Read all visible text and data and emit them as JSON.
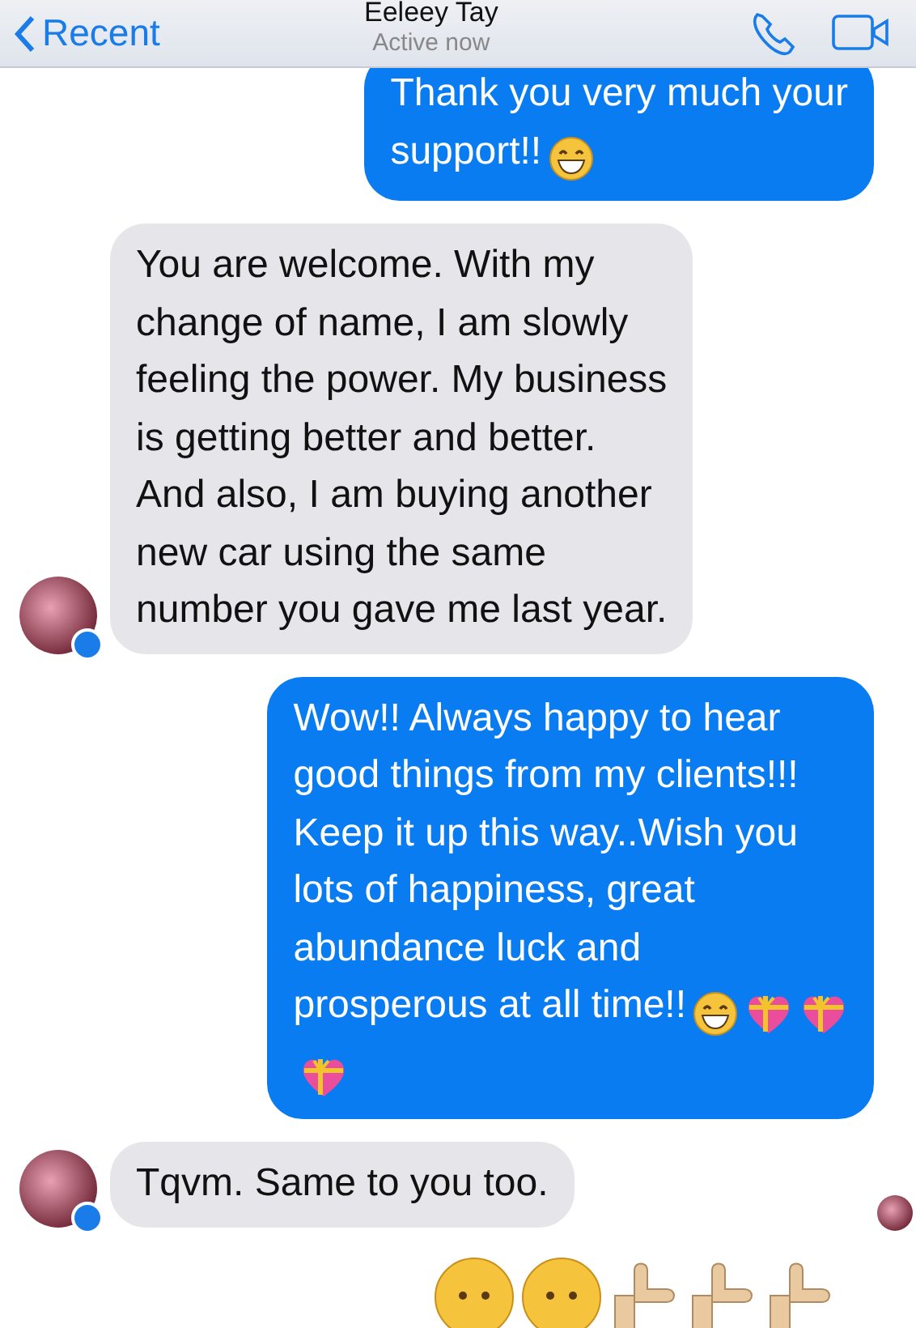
{
  "header": {
    "back_label": "Recent",
    "title": "Eeleey Tay",
    "status": "Active now"
  },
  "messages": [
    {
      "kind": "outgoing",
      "lines": [
        {
          "text": "Thank you very much your"
        },
        {
          "text": "support!!",
          "emoji": [
            {
              "kind": "grin"
            }
          ]
        }
      ]
    },
    {
      "kind": "incoming",
      "avatar": true,
      "lines": [
        {
          "text": "You are welcome.  With my"
        },
        {
          "text": "change of name, I am slowly"
        },
        {
          "text": "feeling the power. My business"
        },
        {
          "text": "is getting better and better."
        },
        {
          "text": "And also, I  am buying another"
        },
        {
          "text": "new car using the same"
        },
        {
          "text": "number you gave me last year."
        }
      ]
    },
    {
      "kind": "outgoing",
      "lines": [
        {
          "text": "Wow!! Always happy to hear"
        },
        {
          "text": "good things from my clients!!!"
        },
        {
          "text": "Keep it up this way..Wish you"
        },
        {
          "text": "lots of happiness, great"
        },
        {
          "text": "abundance luck and"
        },
        {
          "text": "prosperous at all time!!",
          "emoji": [
            {
              "kind": "grin"
            },
            {
              "kind": "gift-heart"
            },
            {
              "kind": "gift-heart"
            }
          ]
        },
        {
          "emoji": [
            {
              "kind": "gift-heart"
            }
          ]
        }
      ]
    },
    {
      "kind": "incoming",
      "avatar": true,
      "lines": [
        {
          "text": "Tqvm. Same to you too."
        }
      ]
    }
  ],
  "read_receipt": true,
  "bottom_emoji": [
    {
      "kind": "face"
    },
    {
      "kind": "face"
    },
    {
      "kind": "thumb"
    },
    {
      "kind": "thumb"
    },
    {
      "kind": "thumb"
    }
  ]
}
